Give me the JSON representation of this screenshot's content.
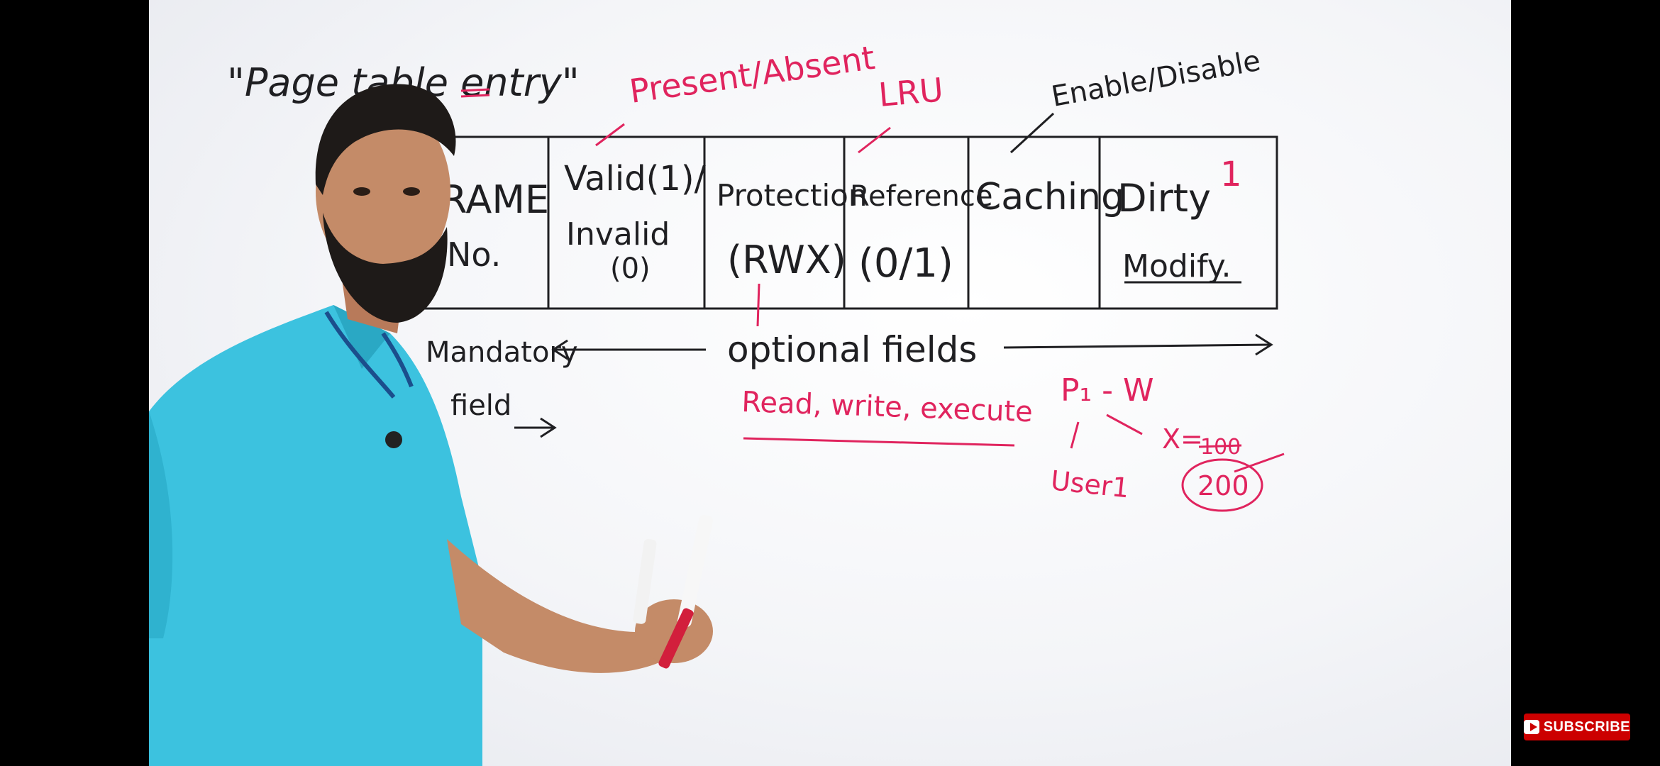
{
  "board": {
    "title": "\"Page table entry\"",
    "columns": [
      {
        "line1": "FRAME",
        "line2": "No.",
        "line3": ""
      },
      {
        "line1": "Valid(1)/",
        "line2": "Invalid",
        "line3": "(0)"
      },
      {
        "line1": "Protection",
        "line2": "(RWX)",
        "line3": ""
      },
      {
        "line1": "Reference",
        "line2": "(0/1)",
        "line3": ""
      },
      {
        "line1": "Caching",
        "line2": "",
        "line3": ""
      },
      {
        "line1": "Dirty",
        "line2": "Modify.",
        "line3": ""
      }
    ],
    "annotations": {
      "present_absent": "Present/Absent",
      "lru": "LRU",
      "enable_disable": "Enable/Disable",
      "dirty_bit": "1",
      "mandatory": "Mandatory",
      "field": "field",
      "optional_fields": "optional fields",
      "read_write_execute": "Read, write, execute",
      "p1_w": "P₁ - W",
      "user1": "User1",
      "x_eq": "X=",
      "x_old": "100",
      "x_new": "200"
    },
    "colors": {
      "ink": "#1f1f22",
      "red_ink": "#e0245e",
      "shirt": "#3cc2df"
    }
  },
  "subscribe": {
    "label": "SUBSCRIBE",
    "icon": "play-icon"
  }
}
